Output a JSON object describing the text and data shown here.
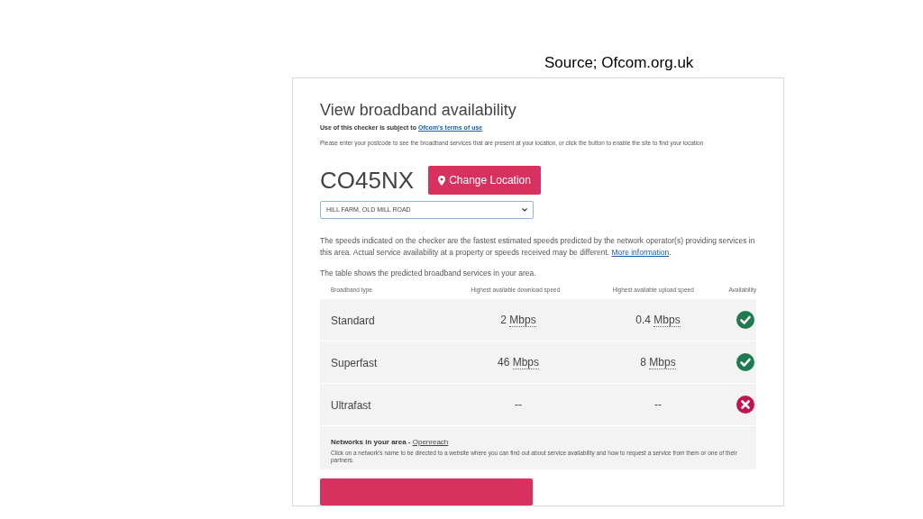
{
  "caption": "Source; Ofcom.org.uk",
  "page": {
    "title": "View broadband availability",
    "terms": {
      "text": "Use of this checker is subject to",
      "link": "Ofcom's terms of use"
    },
    "instructions": "Please enter your postcode to see the broadband services that are present at your location, or click the button to enable the site to find your location",
    "postcode": "CO45NX",
    "change_button": "Change Location",
    "address_select": {
      "value": "HILL FARM, OLD MILL ROAD"
    },
    "disclaimer": {
      "text": "The speeds indicated on the checker are the fastest estimated speeds predicted by the network operator(s) providing services in this area. Actual service availability at a property or speeds received may be different.",
      "link": "More information",
      "end": "."
    },
    "table_intro": "The table shows the predicted broadband services in your area.",
    "table": {
      "columns": [
        "Broadband type",
        "Highest available download speed",
        "Highest available upload speed",
        "Availability"
      ],
      "rows": [
        {
          "type": "Standard",
          "download": {
            "value": "2",
            "unit": "Mbps"
          },
          "upload": {
            "value": "0.4",
            "unit": "Mbps"
          },
          "available": true
        },
        {
          "type": "Superfast",
          "download": {
            "value": "46",
            "unit": "Mbps"
          },
          "upload": {
            "value": "8",
            "unit": "Mbps"
          },
          "available": true
        },
        {
          "type": "Ultrafast",
          "download": {
            "value": "--"
          },
          "upload": {
            "value": "--"
          },
          "available": false
        }
      ]
    },
    "networks": {
      "label": "Networks in your area - ",
      "link": "Openreach",
      "note": "Click on a network's name to be directed to a website where you can find out about service availability and how to request a service from them or one of their partners."
    }
  }
}
